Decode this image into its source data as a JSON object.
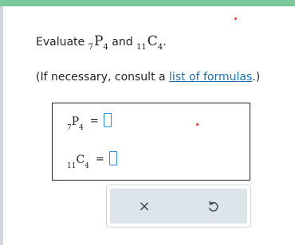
{
  "question": {
    "prefix": "Evaluate ",
    "expr1": {
      "pre": "7",
      "sym": "P",
      "post": "4"
    },
    "conj": " and ",
    "expr2": {
      "pre": "11",
      "sym": "C",
      "post": "4"
    },
    "suffix": "."
  },
  "hint": {
    "before": "(If necessary, consult a ",
    "link": "list of formulas",
    "after": ".)"
  },
  "answers": [
    {
      "pre": "7",
      "sym": "P",
      "post": "4",
      "equals": "=",
      "value": ""
    },
    {
      "pre": "11",
      "sym": "C",
      "post": "4",
      "equals": "=",
      "value": ""
    }
  ],
  "actions": {
    "clear_icon": "×",
    "undo_icon": "undo-icon"
  },
  "colors": {
    "top_bar": "#7bc89a",
    "link": "#1f6fb5",
    "input_border": "#2f8dde",
    "panel_bg": "#dde4ea",
    "dot": "#e03b3b"
  }
}
